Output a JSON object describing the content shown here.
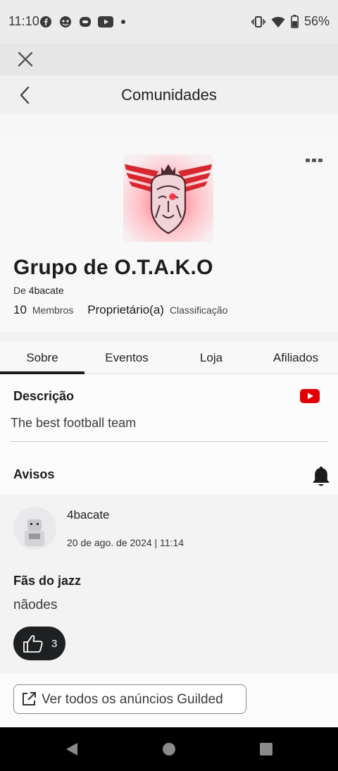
{
  "status_bar": {
    "time": "11:10",
    "battery": "56%"
  },
  "nav": {
    "title": "Comunidades"
  },
  "group": {
    "name": "Grupo de O.T.A.K.O",
    "owner_prefix": "De",
    "owner": "4bacate",
    "member_count": "10",
    "member_label": "Membros",
    "role": "Proprietário(a)",
    "role_label": "Classificação"
  },
  "tabs": [
    "Sobre",
    "Eventos",
    "Loja",
    "Afiliados"
  ],
  "description": {
    "title": "Descrição",
    "text": "The best football team"
  },
  "announcements": {
    "title": "Avisos",
    "post": {
      "author": "4bacate",
      "date": "20 de ago. de 2024 | 11:14",
      "title": "Fãs do jazz",
      "body": "nãodes",
      "likes": "3"
    },
    "view_all": "Ver todos os anúncios Guilded"
  },
  "colors": {
    "youtube": "#e00000",
    "like_button": "#1f2022",
    "logo_accent": "#d8282f"
  }
}
